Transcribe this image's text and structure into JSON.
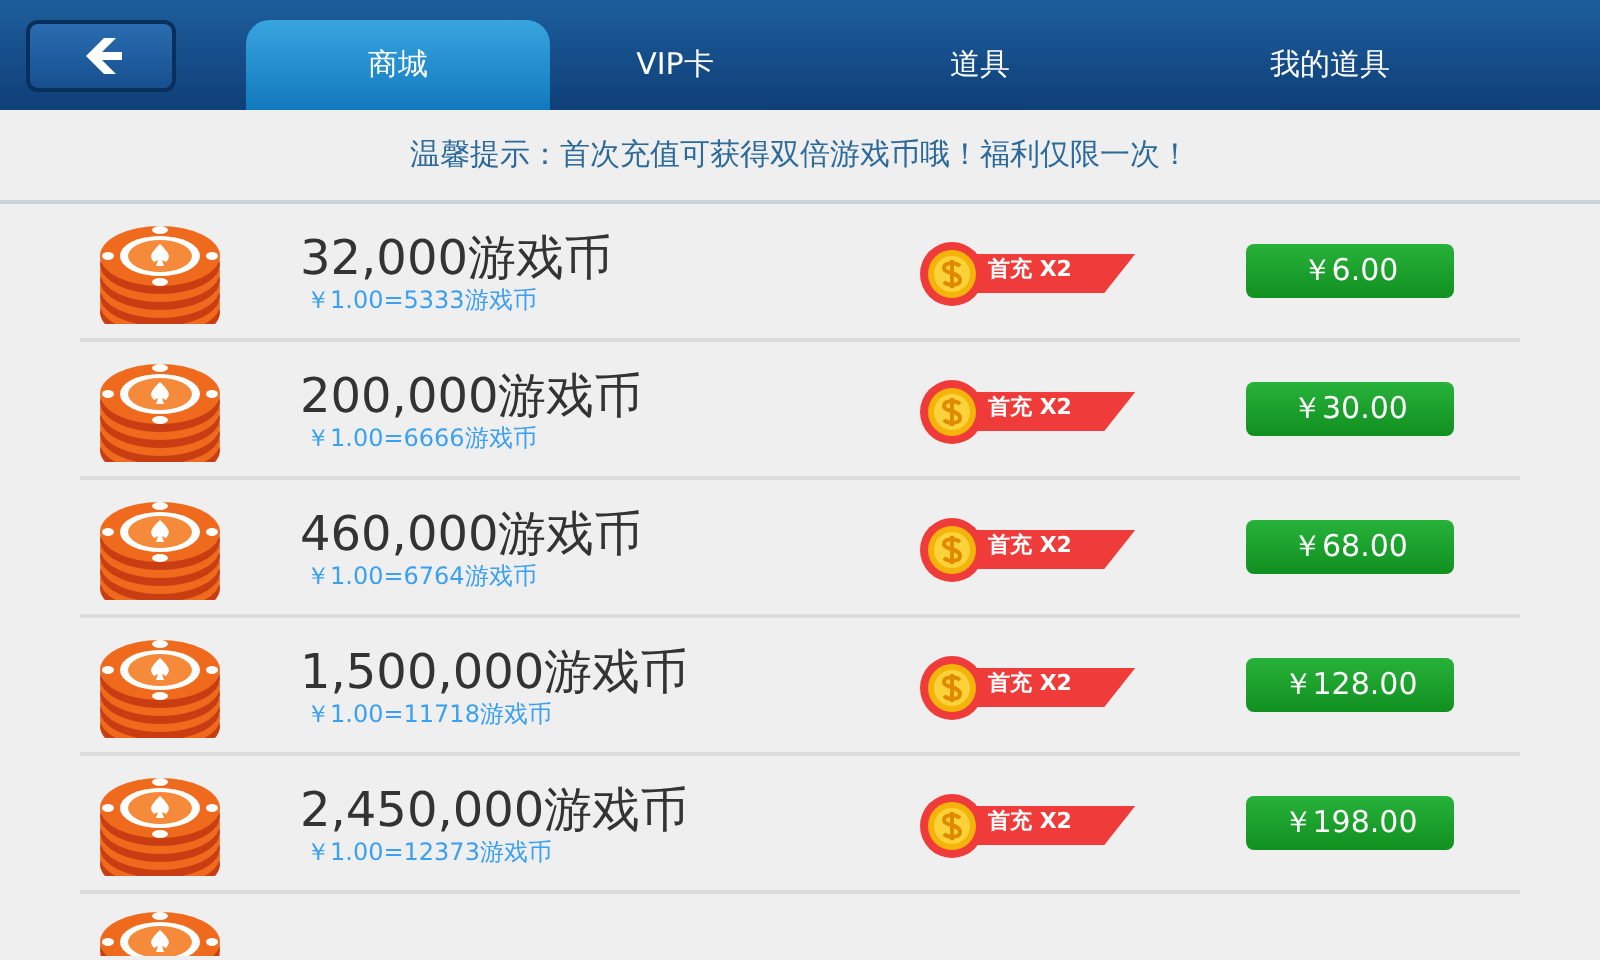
{
  "tabs": [
    {
      "label": "商城",
      "selected": true
    },
    {
      "label": "VIP卡",
      "selected": false
    },
    {
      "label": "道具",
      "selected": false
    },
    {
      "label": "我的道具",
      "selected": false
    }
  ],
  "notice": "温馨提示：首次充值可获得双倍游戏币哦！福利仅限一次！",
  "products": [
    {
      "amount": "32,000游戏币",
      "rate": "￥1.00=5333游戏币",
      "badge": "首充 X2",
      "price": "￥6.00"
    },
    {
      "amount": "200,000游戏币",
      "rate": "￥1.00=6666游戏币",
      "badge": "首充 X2",
      "price": "￥30.00"
    },
    {
      "amount": "460,000游戏币",
      "rate": "￥1.00=6764游戏币",
      "badge": "首充 X2",
      "price": "￥68.00"
    },
    {
      "amount": "1,500,000游戏币",
      "rate": "￥1.00=11718游戏币",
      "badge": "首充 X2",
      "price": "￥128.00"
    },
    {
      "amount": "2,450,000游戏币",
      "rate": "￥1.00=12373游戏币",
      "badge": "首充 X2",
      "price": "￥198.00"
    }
  ]
}
